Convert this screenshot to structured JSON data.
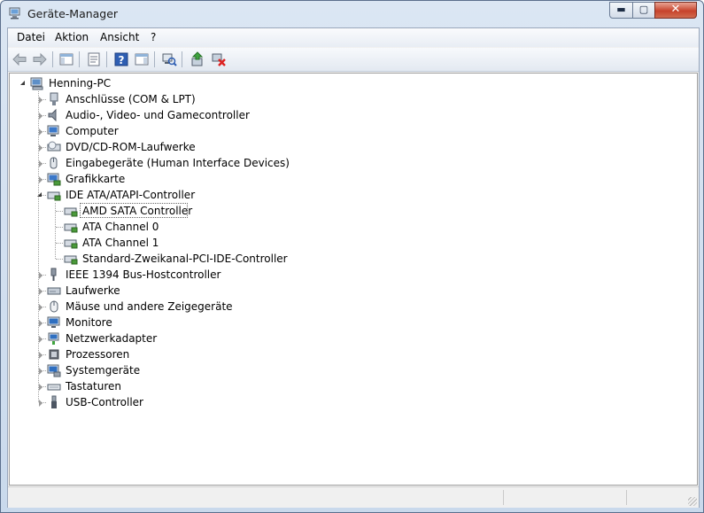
{
  "window": {
    "title": "Geräte-Manager",
    "controls": [
      "minimize",
      "maximize",
      "close"
    ]
  },
  "menu": [
    "Datei",
    "Aktion",
    "Ansicht",
    "?"
  ],
  "toolbar": [
    {
      "name": "back-icon",
      "enabled": false
    },
    {
      "name": "forward-icon",
      "enabled": false
    },
    {
      "name": "show-hide-console-tree-icon",
      "enabled": true
    },
    {
      "name": "properties-icon",
      "enabled": true
    },
    {
      "name": "help-icon",
      "enabled": true
    },
    {
      "name": "show-action-pane-icon",
      "enabled": true
    },
    {
      "name": "scan-hardware-icon",
      "enabled": true
    },
    {
      "name": "update-driver-icon",
      "enabled": true
    },
    {
      "name": "uninstall-icon",
      "enabled": true
    }
  ],
  "tree": {
    "root": "Henning-PC",
    "categories": [
      {
        "label": "Anschlüsse (COM & LPT)",
        "icon": "port-icon",
        "expanded": false
      },
      {
        "label": "Audio-, Video- und Gamecontroller",
        "icon": "speaker-icon",
        "expanded": false
      },
      {
        "label": "Computer",
        "icon": "computer-icon",
        "expanded": false
      },
      {
        "label": "DVD/CD-ROM-Laufwerke",
        "icon": "dvd-drive-icon",
        "expanded": false
      },
      {
        "label": "Eingabegeräte (Human Interface Devices)",
        "icon": "hid-icon",
        "expanded": false
      },
      {
        "label": "Grafikkarte",
        "icon": "display-adapter-icon",
        "expanded": false
      },
      {
        "label": "IDE ATA/ATAPI-Controller",
        "icon": "ide-controller-icon",
        "expanded": true,
        "children": [
          {
            "label": "AMD SATA Controller",
            "selected": true
          },
          {
            "label": "ATA Channel 0",
            "selected": false
          },
          {
            "label": "ATA Channel 1",
            "selected": false
          },
          {
            "label": "Standard-Zweikanal-PCI-IDE-Controller",
            "selected": false
          }
        ]
      },
      {
        "label": "IEEE 1394 Bus-Hostcontroller",
        "icon": "firewire-icon",
        "expanded": false
      },
      {
        "label": "Laufwerke",
        "icon": "disk-drive-icon",
        "expanded": false
      },
      {
        "label": "Mäuse und andere Zeigegeräte",
        "icon": "mouse-icon",
        "expanded": false
      },
      {
        "label": "Monitore",
        "icon": "monitor-icon",
        "expanded": false
      },
      {
        "label": "Netzwerkadapter",
        "icon": "network-adapter-icon",
        "expanded": false
      },
      {
        "label": "Prozessoren",
        "icon": "processor-icon",
        "expanded": false
      },
      {
        "label": "Systemgeräte",
        "icon": "system-devices-icon",
        "expanded": false
      },
      {
        "label": "Tastaturen",
        "icon": "keyboard-icon",
        "expanded": false
      },
      {
        "label": "USB-Controller",
        "icon": "usb-icon",
        "expanded": false
      }
    ]
  }
}
